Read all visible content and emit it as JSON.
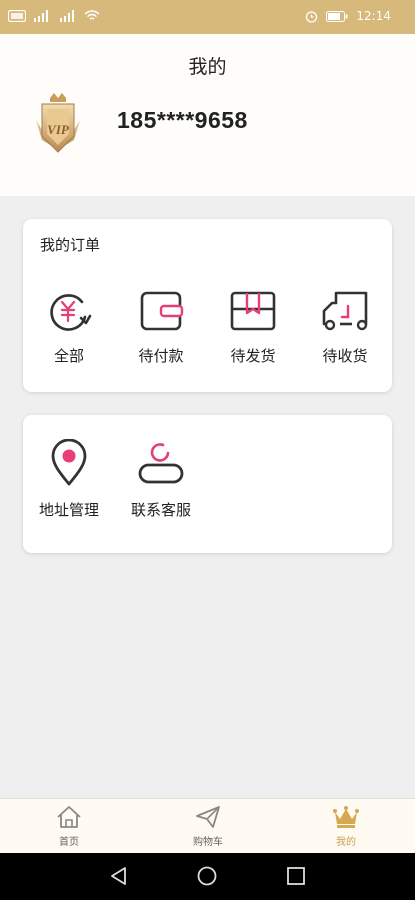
{
  "status_bar": {
    "left_icons": [
      "hd-icon",
      "signal-icon",
      "signal-icon",
      "wifi-icon"
    ],
    "time": "12:14"
  },
  "header": {
    "title": "我的",
    "phone": "185****9658",
    "badge_text": "VIP"
  },
  "orders": {
    "title": "我的订单",
    "items": [
      {
        "label": "全部",
        "icon": "yuan-refresh-icon"
      },
      {
        "label": "待付款",
        "icon": "wallet-icon"
      },
      {
        "label": "待发货",
        "icon": "package-box-icon"
      },
      {
        "label": "待收货",
        "icon": "delivery-truck-icon"
      }
    ]
  },
  "services": {
    "items": [
      {
        "label": "地址管理",
        "icon": "location-pin-icon"
      },
      {
        "label": "联系客服",
        "icon": "user-service-icon"
      }
    ]
  },
  "tabbar": {
    "tabs": [
      {
        "label": "首页",
        "icon": "home-icon"
      },
      {
        "label": "购物车",
        "icon": "paper-plane-icon"
      },
      {
        "label": "我的",
        "icon": "crown-icon",
        "active": true
      }
    ]
  },
  "colors": {
    "accent_gold": "#d7b97c",
    "active_tab": "#c9a254",
    "icon_pink": "#e83e76",
    "icon_dark": "#333333"
  }
}
